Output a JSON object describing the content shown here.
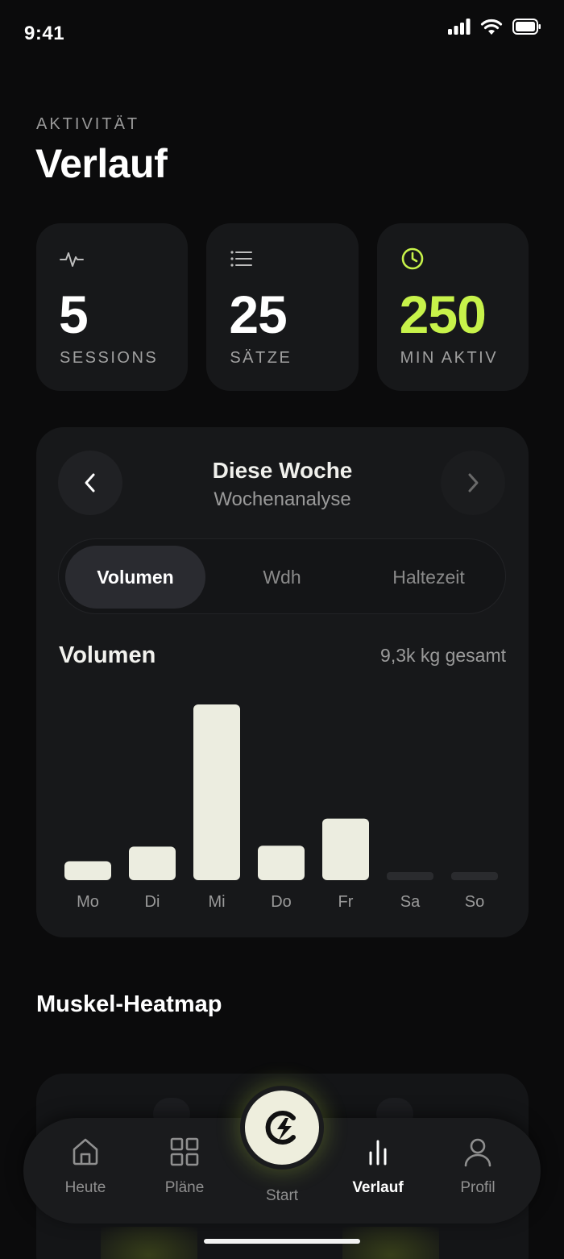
{
  "status_bar": {
    "time": "9:41",
    "signal_icon": "cellular-signal-icon",
    "wifi_icon": "wifi-icon",
    "battery_icon": "battery-icon"
  },
  "header": {
    "eyebrow": "AKTIVITÄT",
    "title": "Verlauf"
  },
  "stats": [
    {
      "value": "5",
      "label": "SESSIONS",
      "icon": "activity-pulse-icon"
    },
    {
      "value": "25",
      "label": "SÄTZE",
      "icon": "list-icon"
    },
    {
      "value": "250",
      "label": "MIN AKTIV",
      "icon": "clock-icon"
    }
  ],
  "colors": {
    "accent": "#c7f24a",
    "bar": "#ecede0",
    "bar_empty": "#2a2b2e",
    "card": "#17181a",
    "background": "#0b0b0c"
  },
  "week": {
    "title": "Diese Woche",
    "subtitle": "Wochenanalyse",
    "prev_icon": "chevron-left-icon",
    "next_icon": "chevron-right-icon",
    "tabs": [
      "Volumen",
      "Wdh",
      "Haltezeit"
    ],
    "selected_tab": "Volumen"
  },
  "chart_data": {
    "type": "bar",
    "title": "Volumen",
    "annotation": "9,3k kg gesamt",
    "categories": [
      "Mo",
      "Di",
      "Mi",
      "Do",
      "Fr",
      "Sa",
      "So"
    ],
    "values": [
      0.44,
      0.78,
      4.08,
      0.8,
      1.43,
      0,
      0
    ],
    "ylim": [
      0,
      4.08
    ],
    "grid": false
  },
  "heatmap": {
    "title": "Muskel-Heatmap"
  },
  "tabbar": {
    "items": [
      {
        "label": "Heute",
        "icon": "home-icon"
      },
      {
        "label": "Pläne",
        "icon": "grid-icon"
      },
      {
        "label": "Start",
        "icon": "lightning-logo-icon"
      },
      {
        "label": "Verlauf",
        "icon": "bar-chart-icon"
      },
      {
        "label": "Profil",
        "icon": "user-icon"
      }
    ],
    "active": "Verlauf"
  }
}
